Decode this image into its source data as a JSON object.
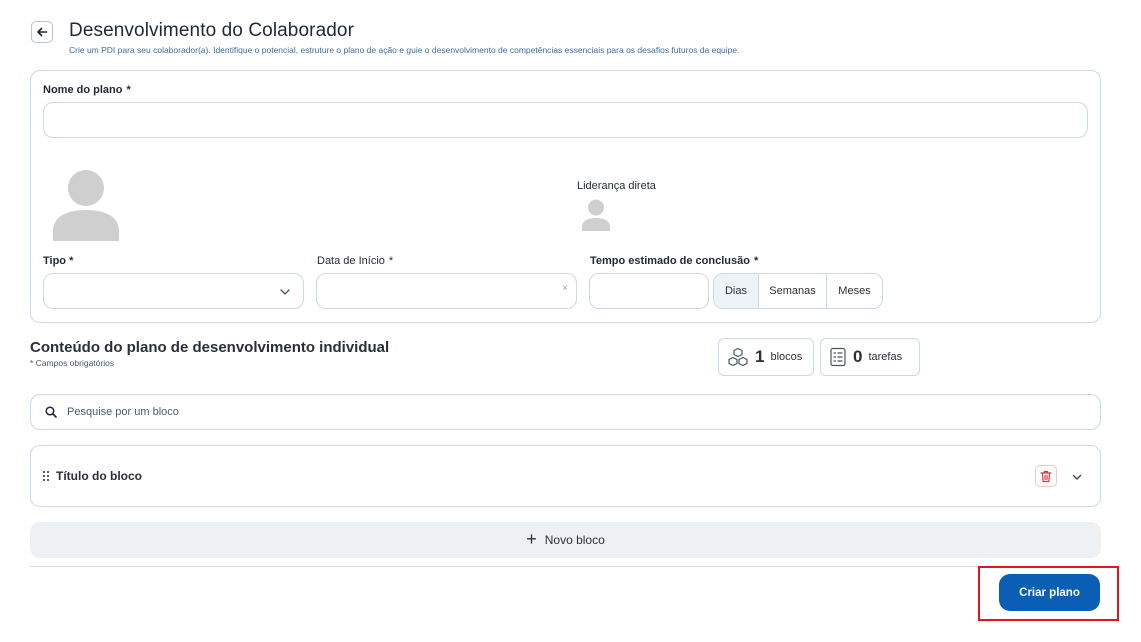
{
  "header": {
    "title": "Desenvolvimento do Colaborador",
    "subtitle": "Crie um PDI para seu colaborador(a). Identifique o potencial, estruture o plano de ação e guie o desenvolvimento de competências essenciais para os desafios futuros da equipe."
  },
  "form": {
    "plan_name_label": "Nome do plano",
    "plan_name_value": "",
    "required_mark": "*",
    "leadership_label": "Liderança direta",
    "type_label": "Tipo *",
    "type_value": "",
    "start_date_label": "Data de Início",
    "start_date_value": "",
    "clear_symbol": "×",
    "duration_label": "Tempo estimado de conclusão",
    "duration_value": "",
    "duration_units": [
      "Dias",
      "Semanas",
      "Meses"
    ],
    "duration_unit_selected": "Dias"
  },
  "content": {
    "title": "Conteúdo do plano de desenvolvimento individual",
    "note": "* Campos obrigatórios",
    "blocks_count": "1",
    "blocks_label": "blocos",
    "tasks_count": "0",
    "tasks_label": "tarefas",
    "search_placeholder": "Pesquise por um bloco",
    "block_title": "Título do bloco",
    "new_block_label": "Novo bloco"
  },
  "footer": {
    "create_label": "Criar plano"
  },
  "colors": {
    "primary": "#0a5fb4",
    "border": "#c9d9e8",
    "highlight": "#e0161e",
    "danger": "#d9363e"
  },
  "icons": [
    "arrow-left-icon",
    "user-avatar-icon",
    "chevron-down-icon",
    "cubes-icon",
    "checklist-icon",
    "search-icon",
    "drag-handle-icon",
    "trash-icon",
    "plus-icon"
  ]
}
